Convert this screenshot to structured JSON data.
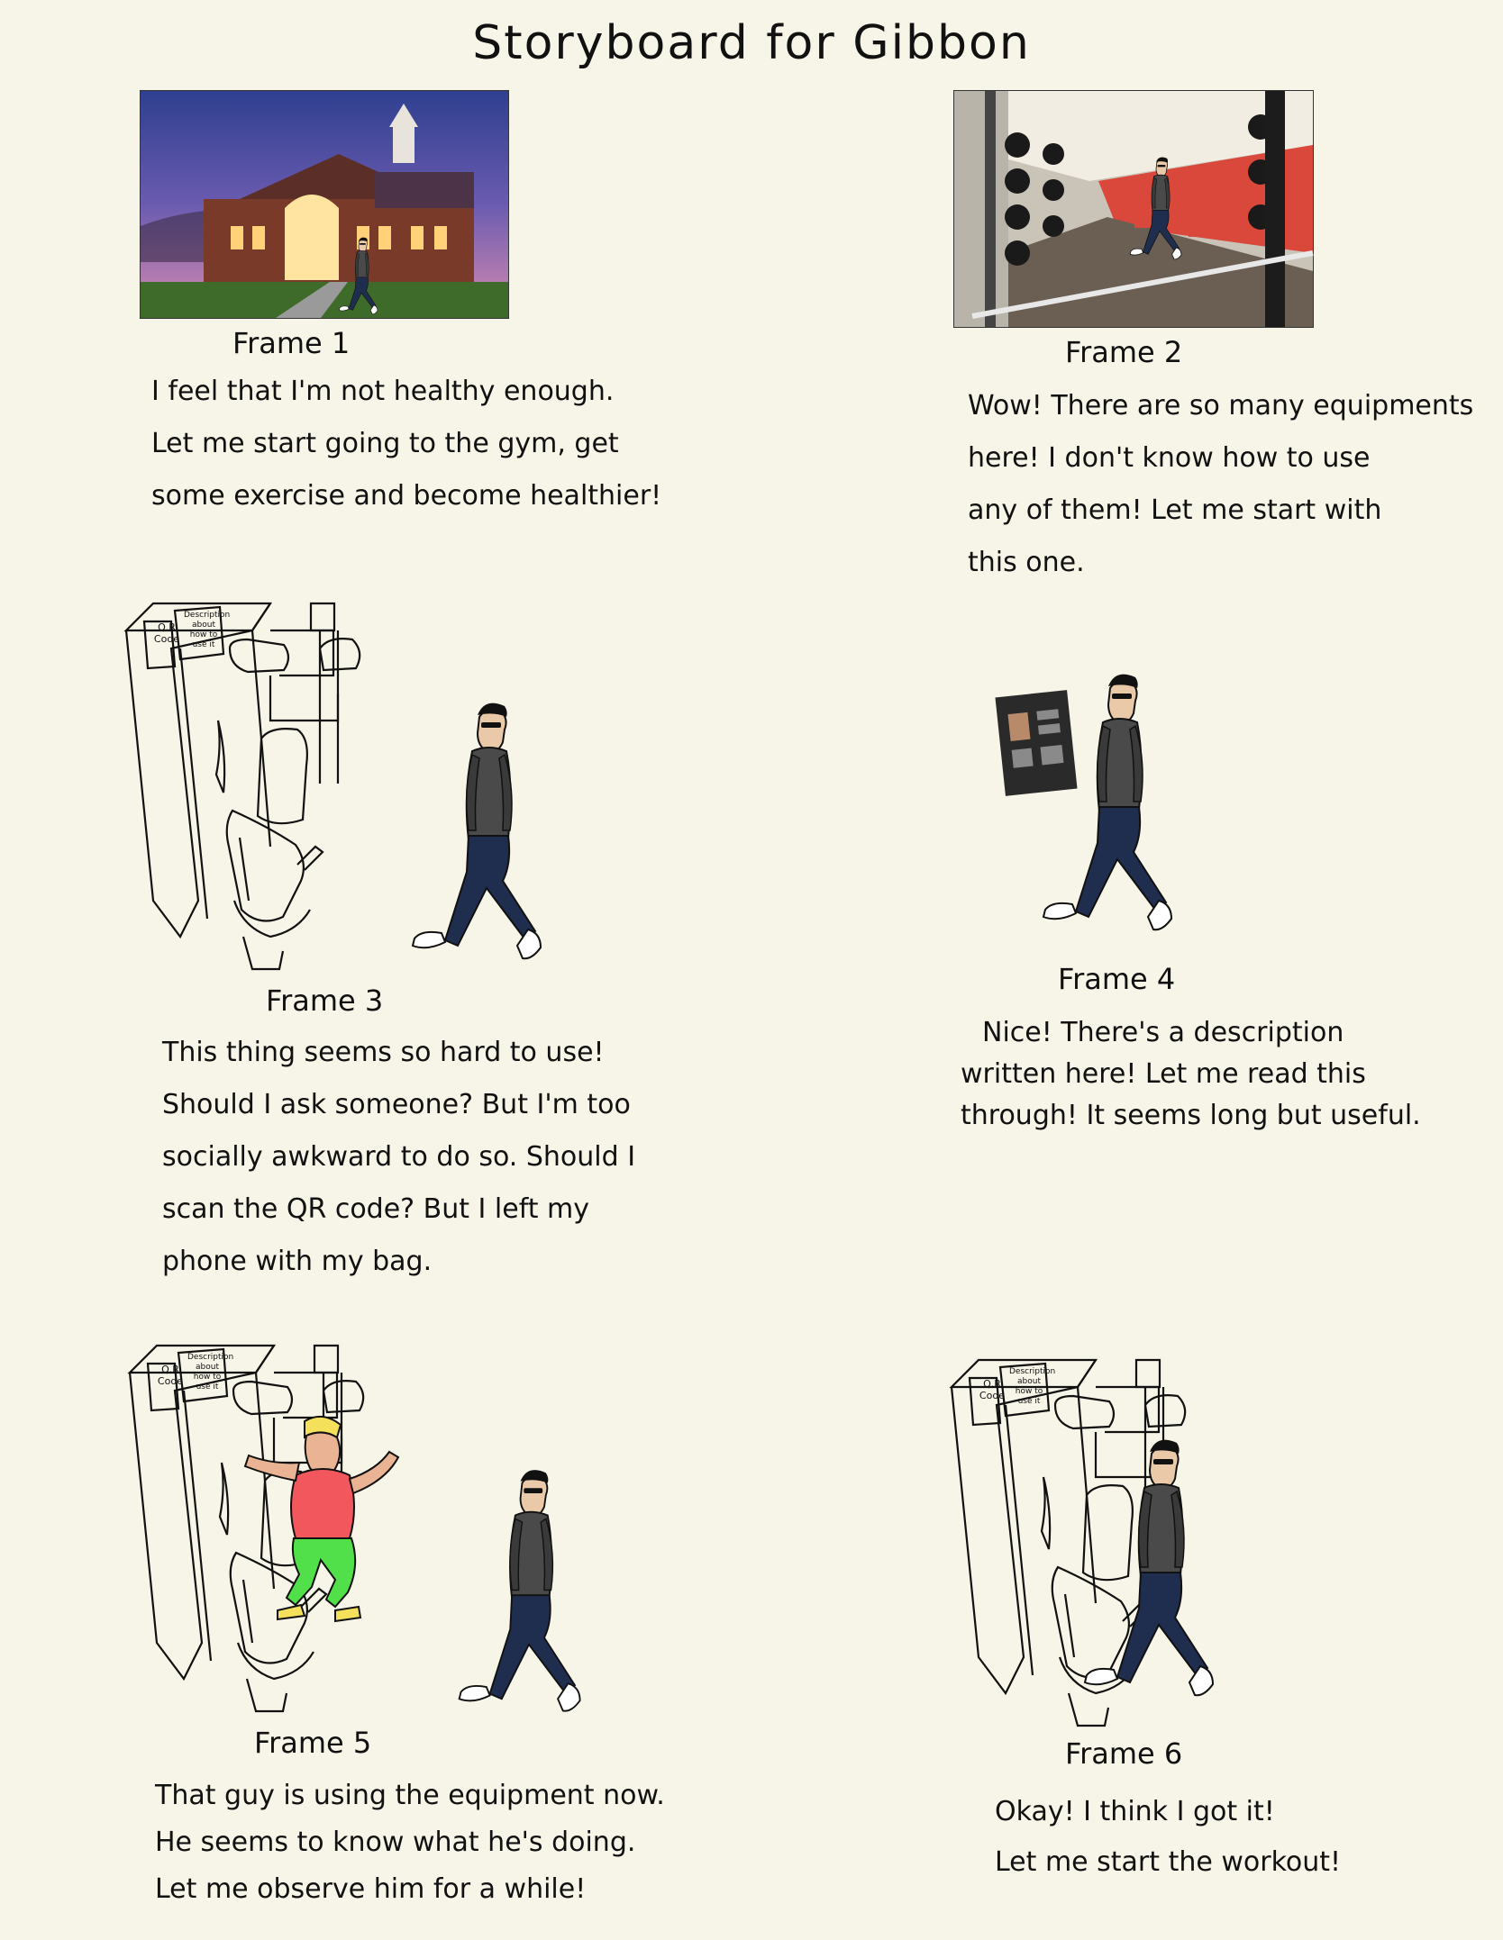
{
  "title": "Storyboard for Gibbon",
  "frames": [
    {
      "label": "Frame 1",
      "lines": [
        "I feel that I'm not healthy enough.",
        "Let me start going to the gym, get",
        "some exercise and become healthier!"
      ]
    },
    {
      "label": "Frame 2",
      "lines": [
        "Wow! There are so many equipments",
        "here! I don't know how to use",
        "any of them! Let me start with",
        "this one."
      ]
    },
    {
      "label": "Frame 3",
      "lines": [
        "This thing seems so hard to use!",
        "Should I ask someone? But I'm too",
        "socially awkward to do so. Should I",
        "scan the QR code? But I left my",
        "phone with my bag."
      ]
    },
    {
      "label": "Frame 4",
      "lines": [
        "Nice! There's a description",
        "written here! Let me read this",
        "through! It seems long but useful."
      ]
    },
    {
      "label": "Frame 5",
      "lines": [
        "That guy is using the equipment now.",
        "He seems to know what he's doing.",
        "Let me observe him for a while!"
      ]
    },
    {
      "label": "Frame 6",
      "lines": [
        "Okay! I think I got it!",
        "Let me start the workout!"
      ]
    }
  ],
  "machine_labels": {
    "qr": [
      "Q.R",
      "Code"
    ],
    "description": [
      "Description",
      "about",
      "how to",
      "use it"
    ]
  }
}
